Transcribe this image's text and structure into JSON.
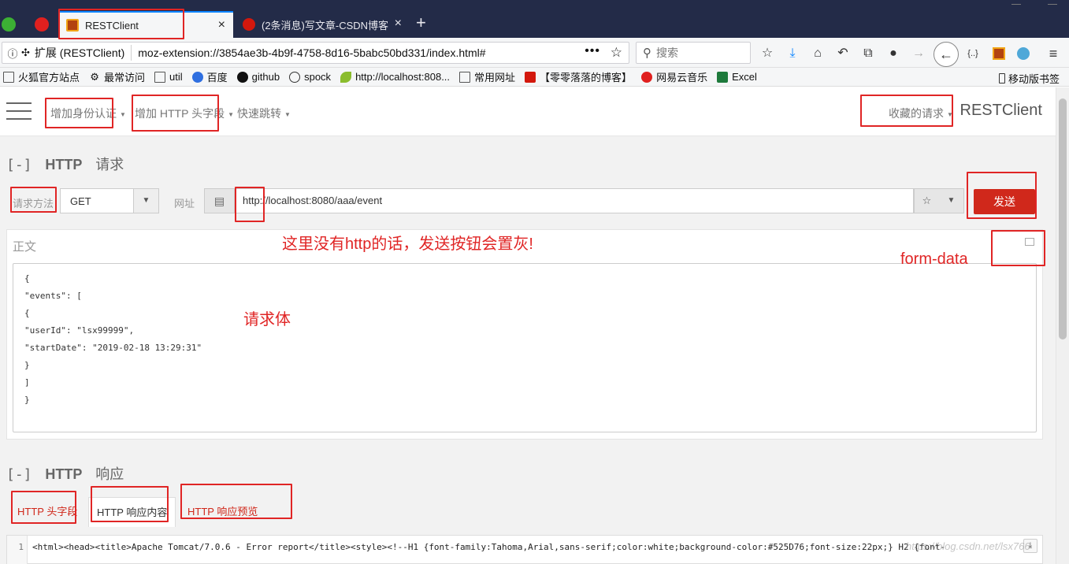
{
  "browser": {
    "tabs": [
      {
        "title": "RESTClient",
        "active": true
      },
      {
        "title": "(2条消息)写文章-CSDN博客",
        "active": false
      }
    ],
    "close_glyph": "×",
    "new_tab_glyph": "+",
    "url_info_label": "扩展 (RESTClient)",
    "url": "moz-extension://3854ae3b-4b9f-4758-8d16-5babc50bd331/index.html#",
    "more_glyph": "•••",
    "search_placeholder": "搜索",
    "bookmarks": [
      {
        "label": "火狐官方站点",
        "icon": "folder-icon"
      },
      {
        "label": "最常访问",
        "icon": "gear-icon"
      },
      {
        "label": "util",
        "icon": "folder-icon"
      },
      {
        "label": "百度",
        "icon": "baidu-icon"
      },
      {
        "label": "github",
        "icon": "github-icon"
      },
      {
        "label": "spock",
        "icon": "globe-icon"
      },
      {
        "label": "http://localhost:808...",
        "icon": "leaf-icon"
      },
      {
        "label": "常用网址",
        "icon": "folder-icon"
      },
      {
        "label": "【零零落落的博客】",
        "icon": "csdn-icon"
      },
      {
        "label": "网易云音乐",
        "icon": "netease-icon"
      },
      {
        "label": "Excel",
        "icon": "excel-icon"
      }
    ],
    "mobile_bookmarks": "移动版书签"
  },
  "app": {
    "brand": "RESTClient",
    "nav": {
      "auth": "增加身份认证",
      "header": "增加 HTTP 头字段",
      "jump": "快速跳转",
      "favorites": "收藏的请求"
    },
    "request": {
      "section_toggle": "[-]",
      "section_http": "HTTP",
      "section_title": "请求",
      "method_label": "请求方法",
      "method": "GET",
      "url_label": "网址",
      "url": "http://localhost:8080/aaa/event",
      "send": "发送",
      "body_label": "正文",
      "body": "{\n\"events\": [\n{\n\"userId\": \"lsx99999\",\n\"startDate\": \"2019-02-18 13:29:31\"\n}\n]\n}"
    },
    "response": {
      "section_toggle": "[-]",
      "section_http": "HTTP",
      "section_title": "响应",
      "tabs": [
        "HTTP 头字段",
        "HTTP 响应内容",
        "HTTP 响应预览"
      ],
      "line_number": "1",
      "code": "<html><head><title>Apache Tomcat/7.0.6 - Error report</title><style><!--H1 {font-family:Tahoma,Arial,sans-serif;color:white;background-color:#525D76;font-size:22px;} H2 {font-"
    }
  },
  "annotations": {
    "http_note": "这里没有http的话，发送按钮会置灰!",
    "form_data": "form-data",
    "request_body": "请求体",
    "color": "#e02525"
  },
  "watermark": "https://blog.csdn.net/lsx766"
}
